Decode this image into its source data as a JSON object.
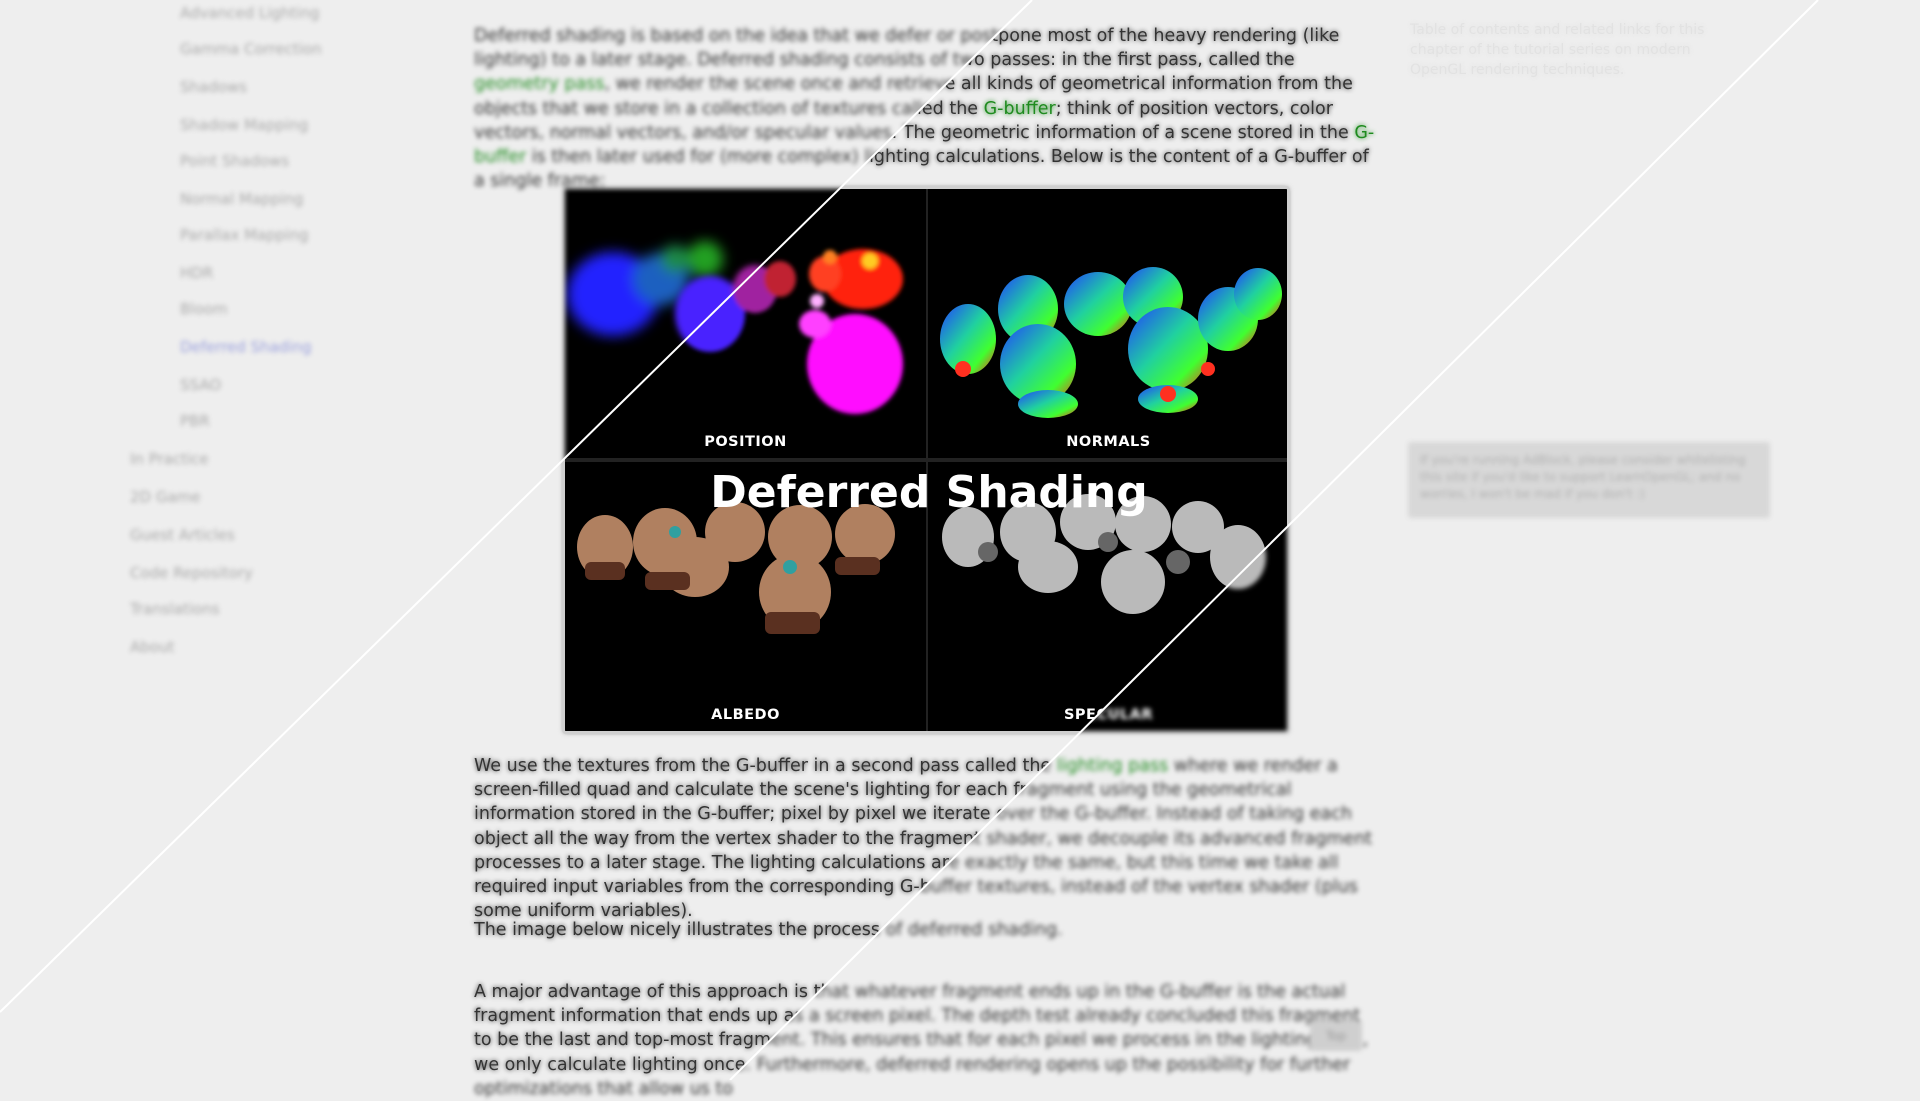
{
  "sidebar": {
    "items": [
      {
        "label": "Advanced Lighting",
        "active": false
      },
      {
        "label": "Gamma Correction",
        "active": false
      },
      {
        "label": "Shadows",
        "active": false
      },
      {
        "label": "Shadow Mapping",
        "active": false
      },
      {
        "label": "Point Shadows",
        "active": false
      },
      {
        "label": "Normal Mapping",
        "active": false
      },
      {
        "label": "Parallax Mapping",
        "active": false
      },
      {
        "label": "HDR",
        "active": false
      },
      {
        "label": "Bloom",
        "active": false
      },
      {
        "label": "Deferred Shading",
        "active": true
      },
      {
        "label": "SSAO",
        "active": false
      },
      {
        "label": "PBR",
        "active": false
      },
      {
        "label": "In Practice",
        "active": false
      },
      {
        "label": "2D Game",
        "active": false
      },
      {
        "label": "Guest Articles",
        "active": false
      },
      {
        "label": "Code Repository",
        "active": false
      },
      {
        "label": "Translations",
        "active": false
      },
      {
        "label": "About",
        "active": false
      }
    ]
  },
  "article": {
    "p1": {
      "a": "Deferred shading is based on the idea that we defer or postpone most of the heavy rendering (like lighting) to a later stage. Deferred shading consists of two passes: in the first pass, called the ",
      "link1": "geometry pass",
      "b": ", we render the scene once and retrieve all kinds of geometrical information from the objects that we store in a collection of textures called the ",
      "link2": "G-buffer",
      "c": "; think of position vectors, color vectors, normal vectors, and/or specular values. The geometric information of a scene stored in the ",
      "link3": "G-buffer",
      "d": " is then later used for (more complex) lighting calculations. Below is the content of a G-buffer of a single frame:"
    },
    "p2": {
      "a": "We use the textures from the G-buffer in a second pass called the ",
      "link1": "lighting pass",
      "b": " where we render a screen-filled quad and calculate the scene's lighting for each fragment using the geometrical information stored in the G-buffer; pixel by pixel we iterate over the G-buffer. Instead of taking each object all the way from the vertex shader to the fragment shader, we decouple its advanced fragment processes to a later stage. The lighting calculations are exactly the same, but this time we take all required input variables from the corresponding G-buffer textures, instead of the vertex shader (plus some uniform variables)."
    },
    "p3": "The image below nicely illustrates the process of deferred shading.",
    "p4": "A major advantage of this approach is that whatever fragment ends up in the G-buffer is the actual fragment information that ends up as a screen pixel. The depth test already concluded this fragment to be the last and top-most fragment. This ensures that for each pixel we process in the lighting pass, we only calculate lighting once. Furthermore, deferred rendering opens up the possibility for further optimizations that allow us to"
  },
  "figure": {
    "title": "Deferred Shading",
    "labels": {
      "position": "POSITION",
      "normals": "NORMALS",
      "albedo": "ALBEDO",
      "specular": "SPECULAR"
    }
  },
  "right_panel": {
    "ghost_text": "Table of contents and related links for this chapter of the tutorial series on modern OpenGL rendering techniques.",
    "box_text": "If you're running AdBlock, please consider whitelisting this site if you'd like to support LearnOpenGL; and no worries, I won't be mad if you don't :)"
  },
  "scroll_button": {
    "label": "Top"
  },
  "colors": {
    "link": "#1f8b1f",
    "background": "#eeeeee",
    "text": "#333333",
    "sidebar_active": "#9aa0dd"
  }
}
